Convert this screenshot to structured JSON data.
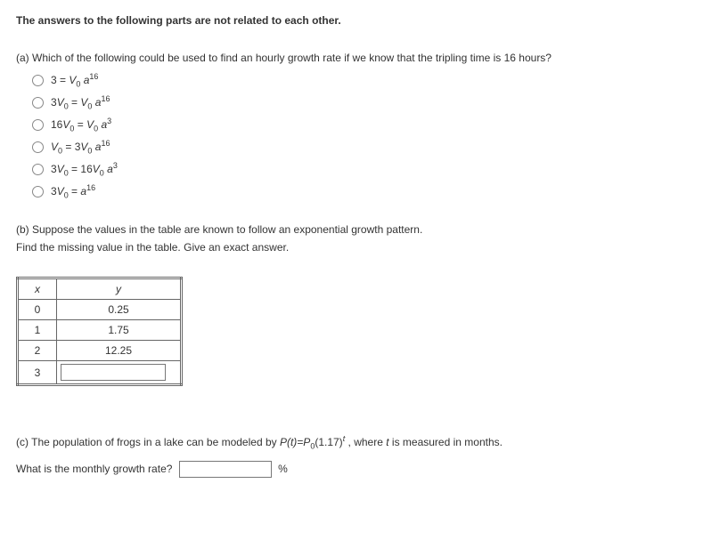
{
  "intro": "The answers to the following parts are not related to each other.",
  "partA": {
    "prompt": "(a) Which of the following could be used to find an hourly growth rate if we know that the tripling time is 16 hours?"
  },
  "partB": {
    "line1": "(b) Suppose the values in the table are known to follow an exponential growth pattern.",
    "line2": "Find the missing value in the table. Give an exact answer.",
    "headers": {
      "x": "x",
      "y": "y"
    },
    "rows": [
      {
        "x": "0",
        "y": "0.25"
      },
      {
        "x": "1",
        "y": "1.75"
      },
      {
        "x": "2",
        "y": "12.25"
      }
    ],
    "lastX": "3"
  },
  "partC": {
    "pre": "(c) The population of frogs in a lake can be modeled by ",
    "formula_lhs": "P(t)=P",
    "formula_base": "(1.17)",
    "post": " , where ",
    "tvar": "t",
    "post2": " is measured in months.",
    "question": "What is the monthly growth rate?",
    "unit": "%"
  }
}
